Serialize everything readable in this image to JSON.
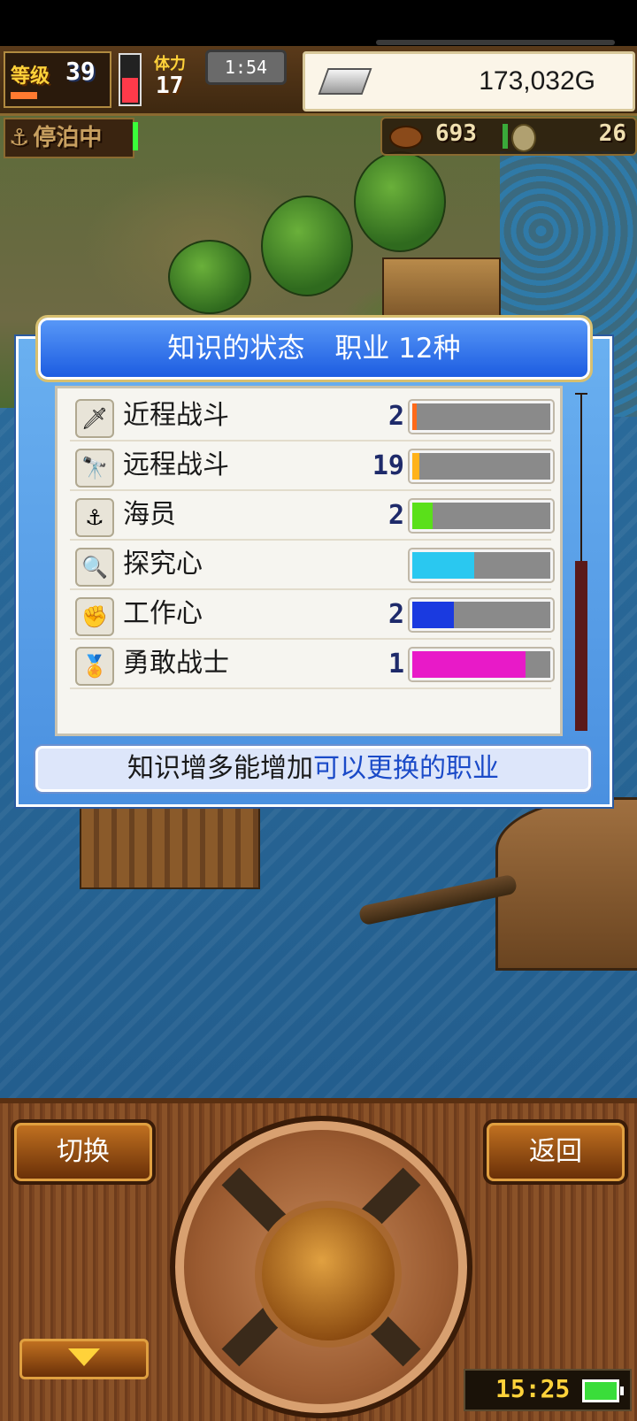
{
  "hud": {
    "level_label": "等级",
    "level": "39",
    "stamina_label": "体力",
    "stamina": "17",
    "timer": "1:54",
    "gold": "173,032G"
  },
  "dock": {
    "status": "停泊中",
    "food": "693",
    "medals": "26"
  },
  "dialog": {
    "title_main": "知识的状态",
    "title_sub": "职业 12种",
    "hint_prefix": "知识增多能增加",
    "hint_highlight": "可以更换的职业"
  },
  "knowledge": [
    {
      "label": "近程战斗",
      "level": "2",
      "icon": "sword-icon",
      "glyph": "🗡",
      "fill": 0.03,
      "color": "#ff6a1a"
    },
    {
      "label": "远程战斗",
      "level": "19",
      "icon": "telescope-icon",
      "glyph": "🔭",
      "fill": 0.05,
      "color": "#ffb21a"
    },
    {
      "label": "海员",
      "level": "2",
      "icon": "anchor-icon",
      "glyph": "⚓",
      "fill": 0.15,
      "color": "#5ae01a"
    },
    {
      "label": "探究心",
      "level": "",
      "icon": "magnifier-icon",
      "glyph": "🔍",
      "fill": 0.45,
      "color": "#2ac8f0"
    },
    {
      "label": "工作心",
      "level": "2",
      "icon": "fist-icon",
      "glyph": "✊",
      "fill": 0.3,
      "color": "#1a3ae0"
    },
    {
      "label": "勇敢战士",
      "level": "1",
      "icon": "medal-icon",
      "glyph": "🏅",
      "fill": 0.82,
      "color": "#e81ac8"
    }
  ],
  "controller": {
    "switch_label": "切换",
    "back_label": "返回",
    "clock": "15:25"
  },
  "colors": {
    "dialog_blue": "#4a90e0",
    "hint_highlight": "#1a4ac8",
    "wood": "#7a4420"
  }
}
